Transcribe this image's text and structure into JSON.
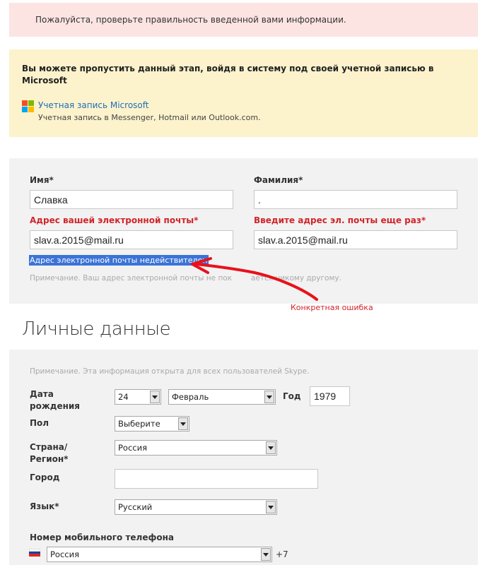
{
  "alert": {
    "text": "Пожалуйста, проверьте правильность введенной вами информации."
  },
  "skip": {
    "title": "Вы можете пропустить данный этап, войдя в систему под своей учетной записью в Microsoft",
    "link": "Учетная запись Microsoft",
    "sub": "Учетная запись в Messenger, Hotmail или Outlook.com.",
    "logo_colors": [
      "#f25022",
      "#7fba00",
      "#00a4ef",
      "#ffb900"
    ]
  },
  "account": {
    "first_name_label": "Имя*",
    "first_name_value": "Славка",
    "last_name_label": "Фамилия*",
    "last_name_value": ".",
    "email_label": "Адрес вашей электронной почты*",
    "email_value": "slav.a.2015@mail.ru",
    "email_repeat_label": "Введите адрес эл. почты еще раз*",
    "email_repeat_value": "slav.a.2015@mail.ru",
    "email_error": "Адрес электронной почты недействителен",
    "note_left": "Примечание. Ваш адрес электронной почты не пок",
    "note_right": "ается никому другому."
  },
  "annotation": {
    "label": "Конкретная ошибка",
    "color": "#e8111a"
  },
  "personal": {
    "title": "Личные данные",
    "note": "Примечание. Эта информация открыта для всех пользователей Skype.",
    "birth_label_1": "Дата",
    "birth_label_2": "рождения",
    "day": "24",
    "month": "Февраль",
    "year_label": "Год",
    "year": "1979",
    "gender_label": "Пол",
    "gender": "Выберите",
    "country_label_1": "Страна/",
    "country_label_2": "Регион*",
    "country": "Россия",
    "city_label": "Город",
    "city": "",
    "language_label": "Язык*",
    "language": "Русский",
    "phone_label": "Номер мобильного телефона",
    "phone_country": "Россия",
    "phone_code": "+7",
    "flag_colors": [
      "#ffffff",
      "#1c3f9e",
      "#d52b1e"
    ]
  }
}
